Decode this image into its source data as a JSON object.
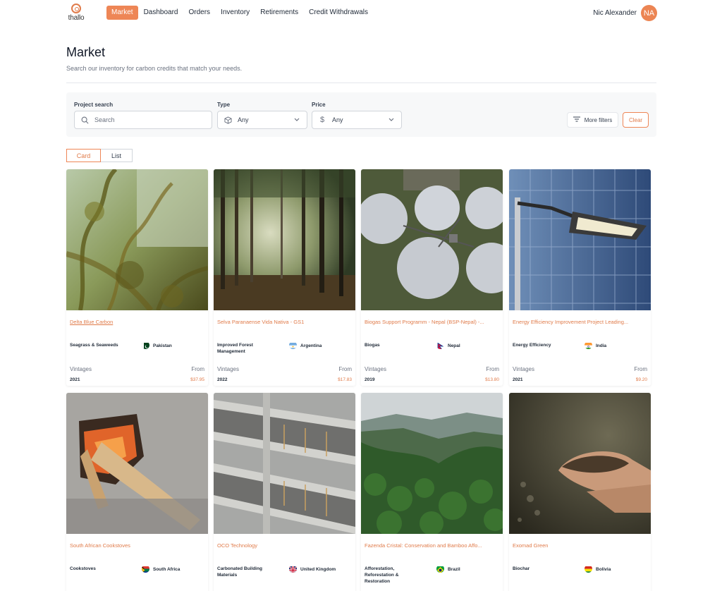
{
  "brand": {
    "name": "thallo",
    "accent": "#ee8656"
  },
  "nav": {
    "items": [
      {
        "label": "Market",
        "active": true
      },
      {
        "label": "Dashboard",
        "active": false
      },
      {
        "label": "Orders",
        "active": false
      },
      {
        "label": "Inventory",
        "active": false
      },
      {
        "label": "Retirements",
        "active": false
      },
      {
        "label": "Credit Withdrawals",
        "active": false
      }
    ]
  },
  "user": {
    "name": "Nic Alexander",
    "initials": "NA"
  },
  "header": {
    "title": "Market",
    "subtitle": "Search our inventory for carbon credits that match your needs."
  },
  "filters": {
    "search": {
      "label": "Project search",
      "placeholder": "Search",
      "icon": "search-icon"
    },
    "type": {
      "label": "Type",
      "value": "Any",
      "icon": "cube-icon"
    },
    "price": {
      "label": "Price",
      "value": "Any",
      "icon": "dollar-icon"
    },
    "more_filters_label": "More filters",
    "clear_label": "Clear"
  },
  "view_toggle": {
    "card_label": "Card",
    "list_label": "List",
    "selected": "Card"
  },
  "card_labels": {
    "vintages": "Vintages",
    "from": "From"
  },
  "cards": [
    {
      "title": "Delta Blue Carbon",
      "type": "Seagrass & Seaweeds",
      "country": "Pakistan",
      "vintage": "2021",
      "price": "$37.95",
      "image": "seaweed-underwater"
    },
    {
      "title": "Selva Paranaense Vida Nativa - GS1",
      "type": "Improved Forest Management",
      "country": "Argentina",
      "vintage": "2022",
      "price": "$17.83",
      "image": "forest-sunlight"
    },
    {
      "title": "Biogas Support Programm - Nepal (BSP-Nepal) -...",
      "type": "Biogas",
      "country": "Nepal",
      "vintage": "2019",
      "price": "$13.80",
      "image": "biogas-tanks"
    },
    {
      "title": "Energy Efficiency Improvement Project Leading...",
      "type": "Energy Efficiency",
      "country": "India",
      "vintage": "2021",
      "price": "$9.20",
      "image": "street-lamp"
    },
    {
      "title": "South African Cookstoves",
      "type": "Cookstoves",
      "country": "South Africa",
      "image": "cookstove-fire"
    },
    {
      "title": "OCO Technology",
      "type": "Carbonated Building Materials",
      "country": "United Kingdom",
      "image": "concrete-building"
    },
    {
      "title": "Fazenda Cristal: Conservation and Bamboo Affo...",
      "type": "Afforestation, Reforestation & Restoration",
      "country": "Brazil",
      "image": "rainforest-valley"
    },
    {
      "title": "Exomad Green",
      "type": "Biochar",
      "country": "Bolivia",
      "image": "hands-soil"
    }
  ]
}
